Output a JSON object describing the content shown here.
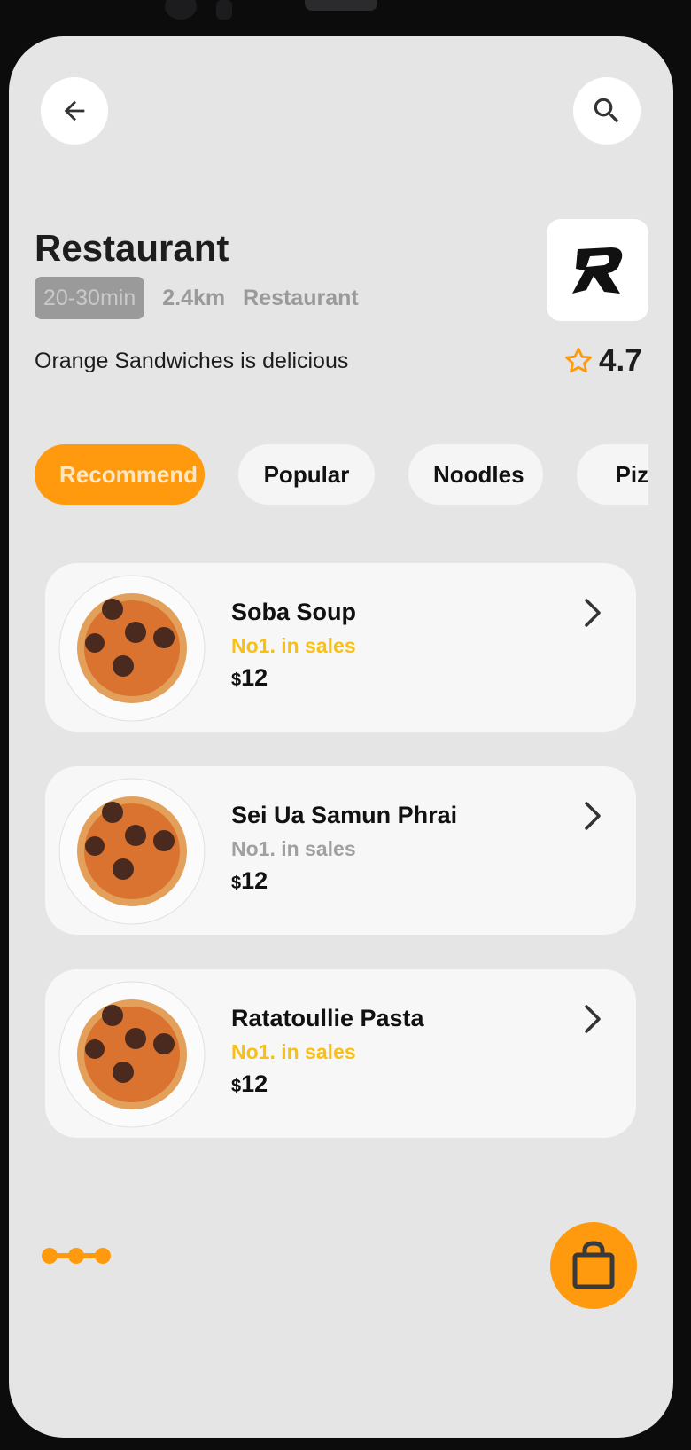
{
  "header": {
    "back_icon": "arrow-left-icon",
    "search_icon": "search-icon"
  },
  "restaurant": {
    "title": "Restaurant",
    "delivery_time": "20-30min",
    "distance": "2.4km",
    "category": "Restaurant",
    "description": "Orange Sandwiches is delicious",
    "rating": "4.7",
    "logo_letter": "R"
  },
  "tabs": [
    {
      "label": "Recommend",
      "active": true
    },
    {
      "label": "Popular",
      "active": false
    },
    {
      "label": "Noodles",
      "active": false
    },
    {
      "label": "Pizza",
      "active": false
    }
  ],
  "menu_items": [
    {
      "name": "Soba Soup",
      "tag": "No1. in sales",
      "tag_color": "#f8c012",
      "currency": "$",
      "price": "12"
    },
    {
      "name": "Sei Ua Samun Phrai",
      "tag": "No1. in sales",
      "tag_color": "#a0a0a0",
      "currency": "$",
      "price": "12"
    },
    {
      "name": "Ratatoullie Pasta",
      "tag": "No1. in sales",
      "tag_color": "#f8c012",
      "currency": "$",
      "price": "12"
    }
  ],
  "colors": {
    "accent": "#ff9a0e",
    "background": "#e5e5e5",
    "card": "#f7f7f7"
  },
  "cart_icon": "shopping-bag-icon"
}
